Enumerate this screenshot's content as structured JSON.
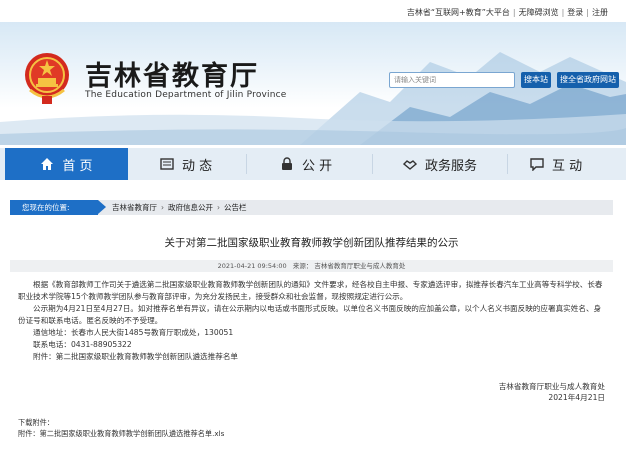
{
  "topbar": {
    "links": [
      "吉林省“互联网+教育”大平台",
      "无障碍浏览",
      "登录",
      "注册"
    ]
  },
  "header": {
    "title": "吉林省教育厅",
    "subtitle": "The Education Department of Jilin Province",
    "search_placeholder": "请输入关键词",
    "search_button": "搜本站",
    "search_all_button": "搜全省政府网站"
  },
  "nav": {
    "items": [
      {
        "label": "首 页",
        "icon": "home-icon"
      },
      {
        "label": "动 态",
        "icon": "news-icon"
      },
      {
        "label": "公 开",
        "icon": "lock-icon"
      },
      {
        "label": "政务服务",
        "icon": "handshake-icon"
      },
      {
        "label": "互 动",
        "icon": "chat-icon"
      }
    ]
  },
  "breadcrumb": {
    "label": "您现在的位置:",
    "items": [
      "吉林省教育厅",
      "政府信息公开",
      "公告栏"
    ]
  },
  "article": {
    "title": "关于对第二批国家级职业教育教师教学创新团队推荐结果的公示",
    "date": "2021-04-21 09:54:00",
    "source": "来源：  吉林省教育厅职业与成人教育处",
    "paragraphs": [
      "根据《教育部教师工作司关于遴选第二批国家级职业教育教师教学创新团队的通知》文件要求，经各校自主申报、专家遴选评审，拟推荐长春汽车工业高等专科学校、长春职业技术学院等15个教师教学团队参与教育部评审，为充分发扬民主，接受群众和社会监督，现按照规定进行公示。",
      "公示期为4月21日至4月27日。如对推荐名单有异议，请在公示期内以电话或书面形式反映。以单位名义书面反映的应加盖公章，以个人名义书面反映的应署真实姓名、身份证号和联系电话。匿名反映的不予受理。"
    ],
    "address": "通信地址：长春市人民大街1485号教育厅职成处，130051",
    "phone": "联系电话：0431-88905322",
    "attachment": "附件：第二批国家级职业教育教师教学创新团队遴选推荐名单",
    "signature_org": "吉林省教育厅职业与成人教育处",
    "signature_date": "2021年4月21日",
    "download_label": "下载附件：",
    "download_file": "附件：第二批国家级职业教育教师教学创新团队遴选推荐名单.xls"
  },
  "colors": {
    "primary": "#1e6fc6",
    "nav_bg": "#e4edf5"
  }
}
